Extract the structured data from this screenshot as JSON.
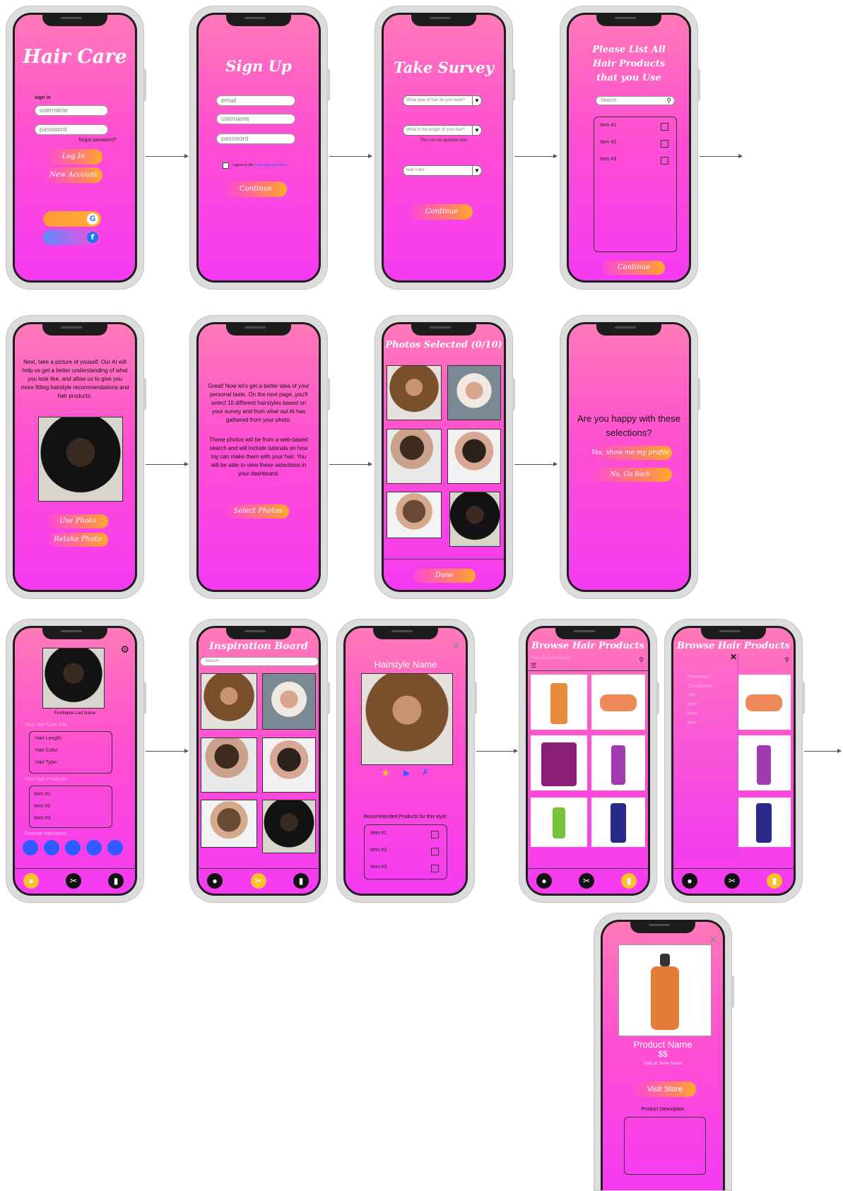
{
  "login": {
    "title": "Hair Care",
    "signin_label": "sign in",
    "username_placeholder": "username",
    "password_placeholder": "password",
    "forgot": "forgot password?",
    "login_button": "Log In",
    "new_account_button": "New Account",
    "google_glyph": "G",
    "facebook_glyph": "f"
  },
  "signup": {
    "title": "Sign Up",
    "email_placeholder": "email",
    "username_placeholder": "username",
    "password_placeholder": "password",
    "agree_text": "I agree to the",
    "terms_link": "terms and conditions",
    "continue_button": "Continue"
  },
  "survey": {
    "title": "Take Survey",
    "q1_placeholder": "What type of hair do you have?",
    "q2_placeholder": "What is the length of your hair?",
    "q2_note": "This can be updated later",
    "q3_placeholder": "Hair color...",
    "continue_button": "Continue"
  },
  "products_list": {
    "title_lines": [
      "Please List All",
      "Hair Products",
      "that you Use"
    ],
    "search_placeholder": "Search",
    "items": [
      "Item #1",
      "Item #2",
      "Item #3"
    ],
    "continue_button": "Continue"
  },
  "take_picture": {
    "text": "Next, take a picture of youself. Our AI will help us get a better understanding of what you look like, and allow us to give you more fitting hairstyle recommendations and hair products.",
    "use_photo_button": "Use Photo",
    "retake_photo_button": "Retake Photo"
  },
  "intro_select": {
    "paragraph1": "Great! Now let's get a better idea of your personal taste. On the next page, you'll select 10 different hairstyles based on your survey and from what out AI has gathered from your photo.",
    "paragraph2": "These photos will be from a web-based search and will include tutorials on how toy can make them with your hair. You will be able to view these selections in your dashboard.",
    "select_button": "Select Photos"
  },
  "photos_selected": {
    "title": "Photos Selected (0/10)",
    "done_button": "Done"
  },
  "confirm": {
    "question": "Are you happy with these selections?",
    "yes_button": "Yes, show me my profile",
    "no_button": "No, Go Back"
  },
  "profile": {
    "name": "FirstName Last Name",
    "hair_info_label": "Your Hair Care Info:",
    "hair_fields": [
      "Hair Length:",
      "Hair Color:",
      "Hair Type:"
    ],
    "products_label": "Your Hair Products:",
    "products": [
      "Item #1",
      "Item #2",
      "Item #3"
    ],
    "favorites_label": "Favorite Hairstyles:"
  },
  "inspiration": {
    "title": "Inspiration Board",
    "search_placeholder": "Search"
  },
  "hairstyle": {
    "title": "Hairstyle Name",
    "recommended_label": "Recommended Products for this style:",
    "items": [
      "Item #1",
      "Item #2",
      "Item #3"
    ]
  },
  "browse": {
    "title": "Browse Hair Products",
    "filter_label": "Filter Recommended",
    "menu_items": [
      "Shampoo",
      "Conditioner",
      "Gel",
      "Item",
      "Item",
      "Item"
    ]
  },
  "product_detail": {
    "name": "Product Name",
    "price": "$$",
    "sold_at": "Sold at: Store Name",
    "visit_button": "Visit Store",
    "description_label": "Product Description"
  },
  "colors": {
    "accent_orange": "#ffad2a",
    "accent_pink": "#ff48d8",
    "favorite_blue": "#2f5bff"
  }
}
